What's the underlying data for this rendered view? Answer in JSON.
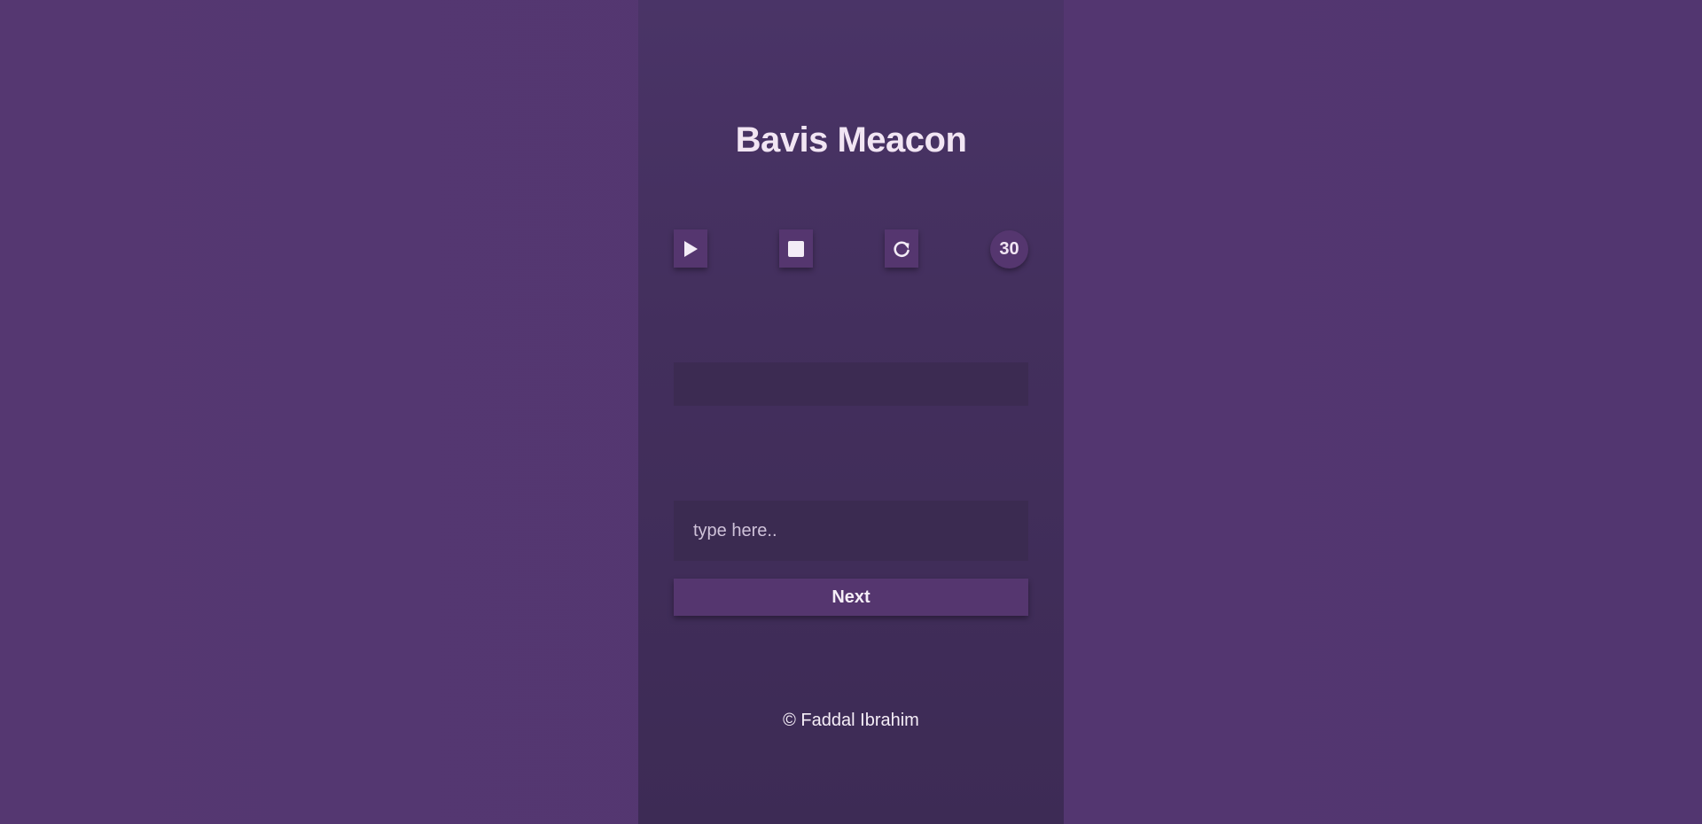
{
  "app": {
    "title": "Bavis Meacon"
  },
  "controls": {
    "play_icon": "play-icon",
    "stop_icon": "stop-icon",
    "restart_icon": "restart-icon",
    "timer_value": "30"
  },
  "word_display": {
    "text": ""
  },
  "typing": {
    "placeholder": "type here..",
    "value": ""
  },
  "actions": {
    "next_label": "Next"
  },
  "footer": {
    "text": "© Faddal Ibrahim"
  },
  "colors": {
    "background": "#533770",
    "panel": "#432f5d",
    "button": "#55366f",
    "input": "#3b2b51",
    "text": "#f1e5f3"
  }
}
